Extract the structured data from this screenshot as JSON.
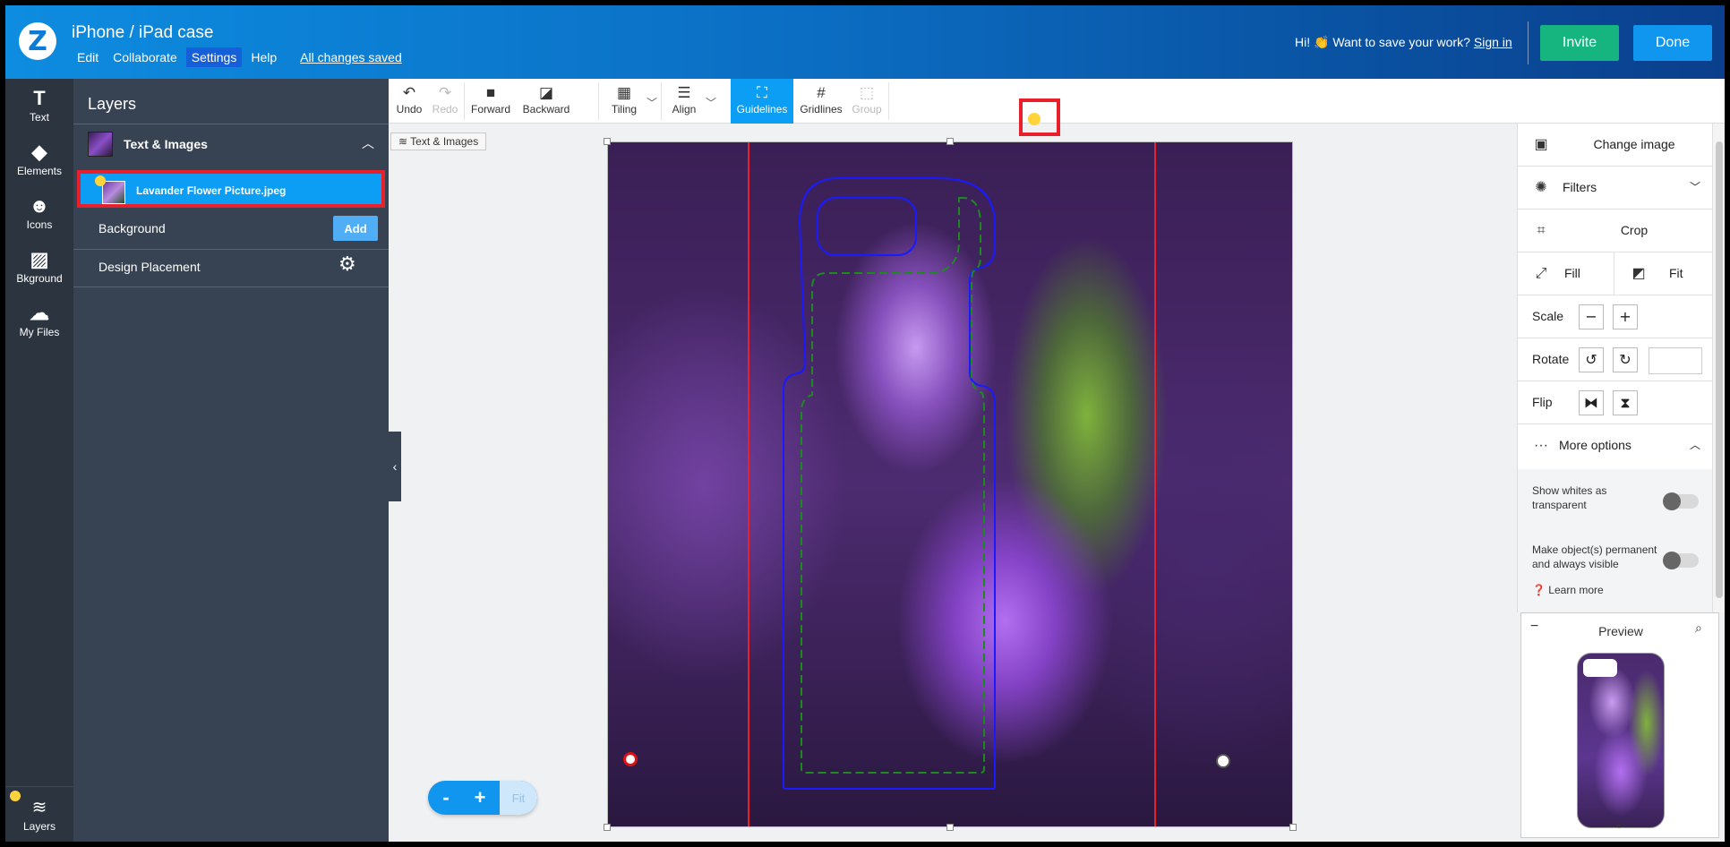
{
  "header": {
    "title": "iPhone / iPad case",
    "logo_letter": "Z",
    "menu": [
      {
        "label": "Edit",
        "active": false
      },
      {
        "label": "Collaborate",
        "active": false
      },
      {
        "label": "Settings",
        "active": true
      },
      {
        "label": "Help",
        "active": false
      }
    ],
    "save_status": "All changes saved",
    "save_prompt": "Hi! 👏 Want to save your work?",
    "signin": "Sign in",
    "invite": "Invite",
    "done": "Done"
  },
  "rail": [
    {
      "label": "Text",
      "icon": "T",
      "icon_name": "text-icon"
    },
    {
      "label": "Elements",
      "icon": "◆",
      "icon_name": "elements-icon"
    },
    {
      "label": "Icons",
      "icon": "☻",
      "icon_name": "smiley-icon"
    },
    {
      "label": "Bkground",
      "icon": "▨",
      "icon_name": "background-pattern-icon"
    },
    {
      "label": "My Files",
      "icon": "☁",
      "icon_name": "cloud-upload-icon"
    }
  ],
  "rail_layers": {
    "label": "Layers",
    "icon": "≋"
  },
  "layers": {
    "title": "Layers",
    "group_label": "Text & Images",
    "selected_layer": "Lavander Flower Picture.jpeg",
    "background_label": "Background",
    "background_add": "Add",
    "design_placement": "Design Placement"
  },
  "toolbar": {
    "undo": "Undo",
    "redo": "Redo",
    "forward": "Forward",
    "backward": "Backward",
    "tiling": "Tiling",
    "align": "Align",
    "guidelines": "Guidelines",
    "gridlines": "Gridlines",
    "group": "Group"
  },
  "canvas": {
    "breadcrumb": "Text & Images",
    "zoom_out": "-",
    "zoom_in": "+",
    "zoom_fit": "Fit"
  },
  "props": {
    "change_image": "Change image",
    "filters": "Filters",
    "crop": "Crop",
    "fill": "Fill",
    "fit": "Fit",
    "scale": "Scale",
    "rotate": "Rotate",
    "flip": "Flip",
    "more_options": "More options",
    "show_whites": "Show whites as transparent",
    "make_permanent": "Make object(s) permanent and always visible",
    "learn_more": "Learn more"
  },
  "preview": {
    "title": "Preview",
    "minimize": "−"
  },
  "colors": {
    "header_start": "#0d8ce0",
    "header_end": "#0a3f8c",
    "invite": "#16b57f",
    "done": "#1196f0",
    "selection_red": "#e8202b",
    "active_tool": "#0c9df5"
  }
}
